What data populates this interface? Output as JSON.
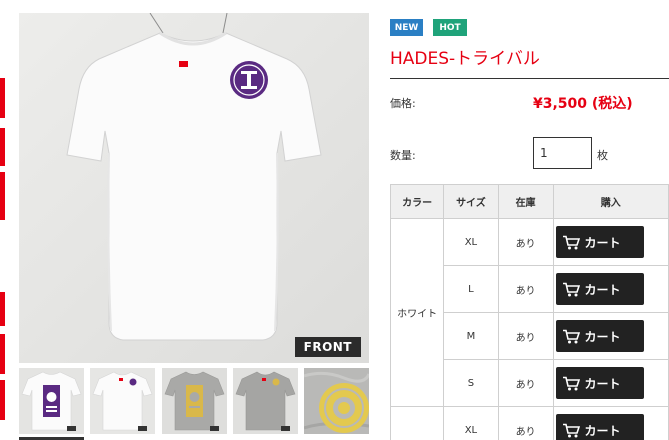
{
  "gallery": {
    "main_badge": "FRONT",
    "main_shirt_color": "#ffffff",
    "print_color": "#5a2a82",
    "thumbs": [
      {
        "icon": "white-tee-back-purple-print"
      },
      {
        "icon": "white-tee-front"
      },
      {
        "icon": "grey-tee-back-yellow-print"
      },
      {
        "icon": "grey-tee-front"
      },
      {
        "icon": "fabric-closeup-yellow-print"
      }
    ]
  },
  "product": {
    "badges": [
      {
        "label": "NEW",
        "color": "#2a7fc4"
      },
      {
        "label": "HOT",
        "color": "#1fa37a"
      }
    ],
    "title": "HADES-トライバル",
    "price_label": "価格:",
    "price": "¥3,500 (税込)",
    "quantity_label": "数量:",
    "quantity_value": "1",
    "quantity_unit": "枚"
  },
  "variants": {
    "headers": [
      "カラー",
      "サイズ",
      "在庫",
      "購入"
    ],
    "groups": [
      {
        "color": "ホワイト",
        "rows": [
          {
            "size": "XL",
            "stock": "あり",
            "action": "カート"
          },
          {
            "size": "L",
            "stock": "あり",
            "action": "カート"
          },
          {
            "size": "M",
            "stock": "あり",
            "action": "カート"
          },
          {
            "size": "S",
            "stock": "あり",
            "action": "カート"
          }
        ]
      },
      {
        "color": "",
        "rows": [
          {
            "size": "XL",
            "stock": "あり",
            "action": "カート"
          }
        ]
      }
    ]
  },
  "theme": {
    "accent": "#e60012",
    "button": "#222222"
  }
}
